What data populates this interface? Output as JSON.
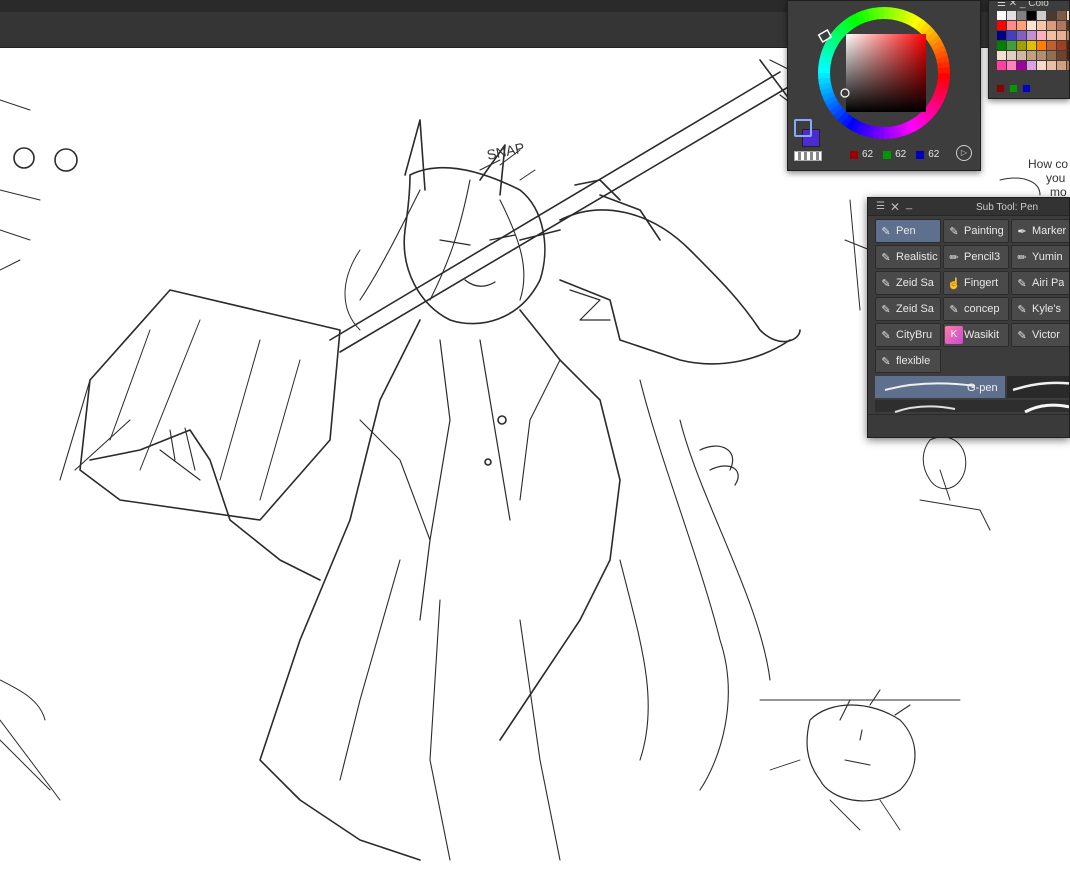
{
  "color_wheel": {
    "rgb": {
      "r": "62",
      "g": "62",
      "b": "62"
    },
    "fg_color": "#7da0ff",
    "bg_color": "#4c2bd0",
    "hue_marker_color": "#ff2a2a"
  },
  "color_set": {
    "title": "Colo",
    "swatches": [
      "#ffffff",
      "#e0e0e0",
      "#808080",
      "#000000",
      "#cccccc",
      "#4b3a2f",
      "#7f5a45",
      "#ffd7c5",
      "#ff0000",
      "#ff8888",
      "#ffa07a",
      "#ffe4d0",
      "#f4c7a9",
      "#d89c7e",
      "#b2765a",
      "#5a3320",
      "#000080",
      "#4040c0",
      "#8060c0",
      "#c090d0",
      "#ffb0c0",
      "#f0c0a0",
      "#e8b090",
      "#c08060",
      "#008000",
      "#40a040",
      "#a0a000",
      "#e0c000",
      "#ff8000",
      "#c06030",
      "#a04020",
      "#602000",
      "#f0e0d0",
      "#e0d0c0",
      "#d0b8a0",
      "#c0a080",
      "#b09070",
      "#907050",
      "#704030",
      "#502010",
      "#ff40a0",
      "#ff80c0",
      "#a000a0",
      "#e0a0e0",
      "#f8d8c8",
      "#e8c0a8",
      "#d0a080",
      "#a87850"
    ],
    "bottom": [
      "#8b0000",
      "#009900",
      "#0000cc"
    ]
  },
  "subtool": {
    "title": "Sub Tool: Pen",
    "tools": [
      {
        "label": "Pen",
        "icon": "pen-icon",
        "selected": true
      },
      {
        "label": "Painting",
        "icon": "pen-icon"
      },
      {
        "label": "Marker",
        "icon": "marker-icon"
      },
      {
        "label": "Realistic",
        "icon": "pen-icon"
      },
      {
        "label": "Pencil3",
        "icon": "pencil-icon"
      },
      {
        "label": "Yumin",
        "icon": "pencil-icon"
      },
      {
        "label": "Zeid Sa",
        "icon": "pen-icon"
      },
      {
        "label": "Fingert",
        "icon": "finger-icon"
      },
      {
        "label": "Airi Pa",
        "icon": "pen-icon"
      },
      {
        "label": "Zeid Sa",
        "icon": "pen-icon"
      },
      {
        "label": "concep",
        "icon": "pen-icon"
      },
      {
        "label": "Kyle's",
        "icon": "pen-icon"
      },
      {
        "label": "CityBru",
        "icon": "pen-icon"
      },
      {
        "label": "Wasikit",
        "icon": "custom-brush-thumbnail"
      },
      {
        "label": "Victor",
        "icon": "pen-icon"
      },
      {
        "label": "flexible",
        "icon": "pen-icon"
      }
    ],
    "brush_selected": "G-pen"
  },
  "canvas": {
    "notes": [
      "SNAP",
      "How co",
      "you",
      "mo"
    ]
  }
}
